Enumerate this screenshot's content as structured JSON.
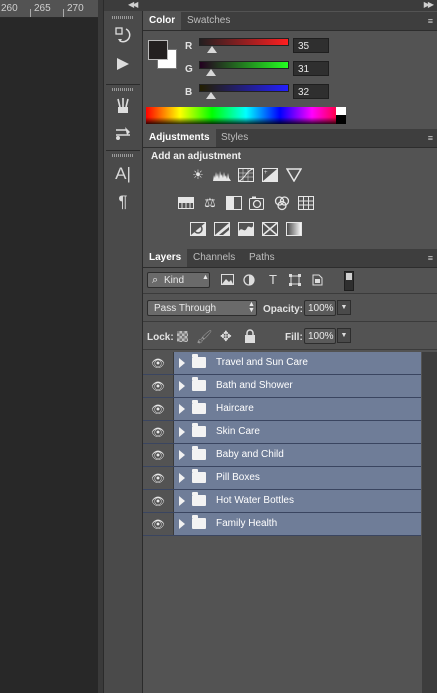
{
  "ruler": {
    "marks": [
      "260",
      "265",
      "270"
    ]
  },
  "color_panel": {
    "tabs": [
      "Color",
      "Swatches"
    ],
    "channels": [
      {
        "label": "R",
        "value": "35",
        "slider_fraction": 0.137
      },
      {
        "label": "G",
        "value": "31",
        "slider_fraction": 0.122
      },
      {
        "label": "B",
        "value": "32",
        "slider_fraction": 0.125
      }
    ],
    "colors": {
      "foreground": "#231f20",
      "background": "#ffffff"
    }
  },
  "adjustments_panel": {
    "tabs": [
      "Adjustments",
      "Styles"
    ],
    "title": "Add an adjustment",
    "icons_row1": [
      "brightness-contrast-icon",
      "levels-icon",
      "curves-icon",
      "exposure-icon",
      "vibrance-icon"
    ],
    "icons_row2": [
      "hue-saturation-icon",
      "color-balance-icon",
      "black-white-icon",
      "photo-filter-icon",
      "channel-mixer-icon",
      "color-lookup-icon"
    ],
    "icons_row3": [
      "invert-icon",
      "posterize-icon",
      "threshold-icon",
      "selective-color-icon",
      "gradient-map-icon"
    ]
  },
  "layers_panel": {
    "tabs": [
      "Layers",
      "Channels",
      "Paths"
    ],
    "filter_kind": "Kind",
    "blend_mode": "Pass Through",
    "opacity_label": "Opacity:",
    "opacity_value": "100%",
    "lock_label": "Lock:",
    "fill_label": "Fill:",
    "fill_value": "100%",
    "layers": [
      {
        "name": "Travel and Sun Care"
      },
      {
        "name": "Bath and Shower"
      },
      {
        "name": "Haircare"
      },
      {
        "name": "Skin Care"
      },
      {
        "name": "Baby and Child"
      },
      {
        "name": "Pill Boxes"
      },
      {
        "name": "Hot Water Bottles"
      },
      {
        "name": "Family Health"
      }
    ]
  },
  "dock": {
    "icons": [
      "history-icon",
      "actions-play-icon",
      "brushes-icon",
      "brush-presets-icon",
      "character-icon",
      "paragraph-icon"
    ]
  }
}
